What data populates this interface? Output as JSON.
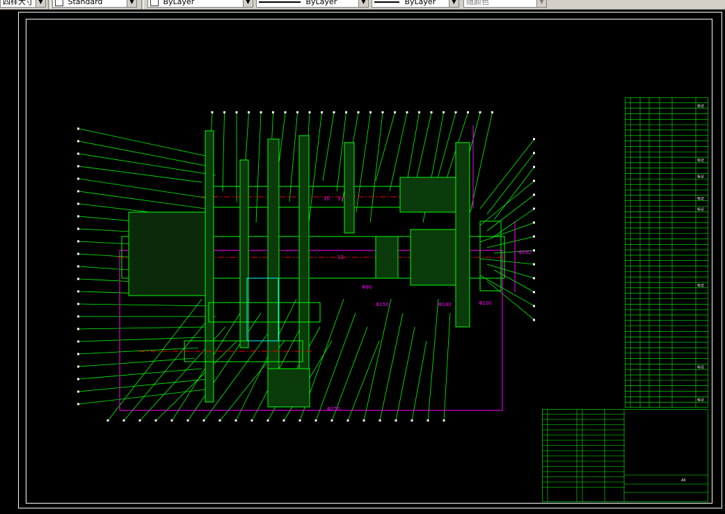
{
  "toolbar": {
    "dimstyle_label": "四样大寸",
    "textstyle_label": "Standard",
    "layer_label": "ByLayer",
    "linetype_label": "ByLayer",
    "lineweight_label": "ByLayer",
    "color_label": "随颜色"
  },
  "drawing": {
    "dim_labels": [
      "Φ250",
      "Φ260",
      "Φ90",
      "Φ150",
      "Φ180",
      "Φ100",
      "10",
      "13",
      "12"
    ],
    "parts_table_notes": [
      "标记",
      "标记",
      "标记",
      "标记",
      "标记",
      "标记",
      "标记",
      "标记"
    ],
    "title_block_notes": [
      "A0"
    ]
  },
  "colors": {
    "background": "#000000",
    "green": "#00ff00",
    "magenta": "#ff00ff",
    "red": "#ff0000",
    "white": "#ffffff",
    "cyan": "#00ffff",
    "yellow": "#ffff00"
  }
}
